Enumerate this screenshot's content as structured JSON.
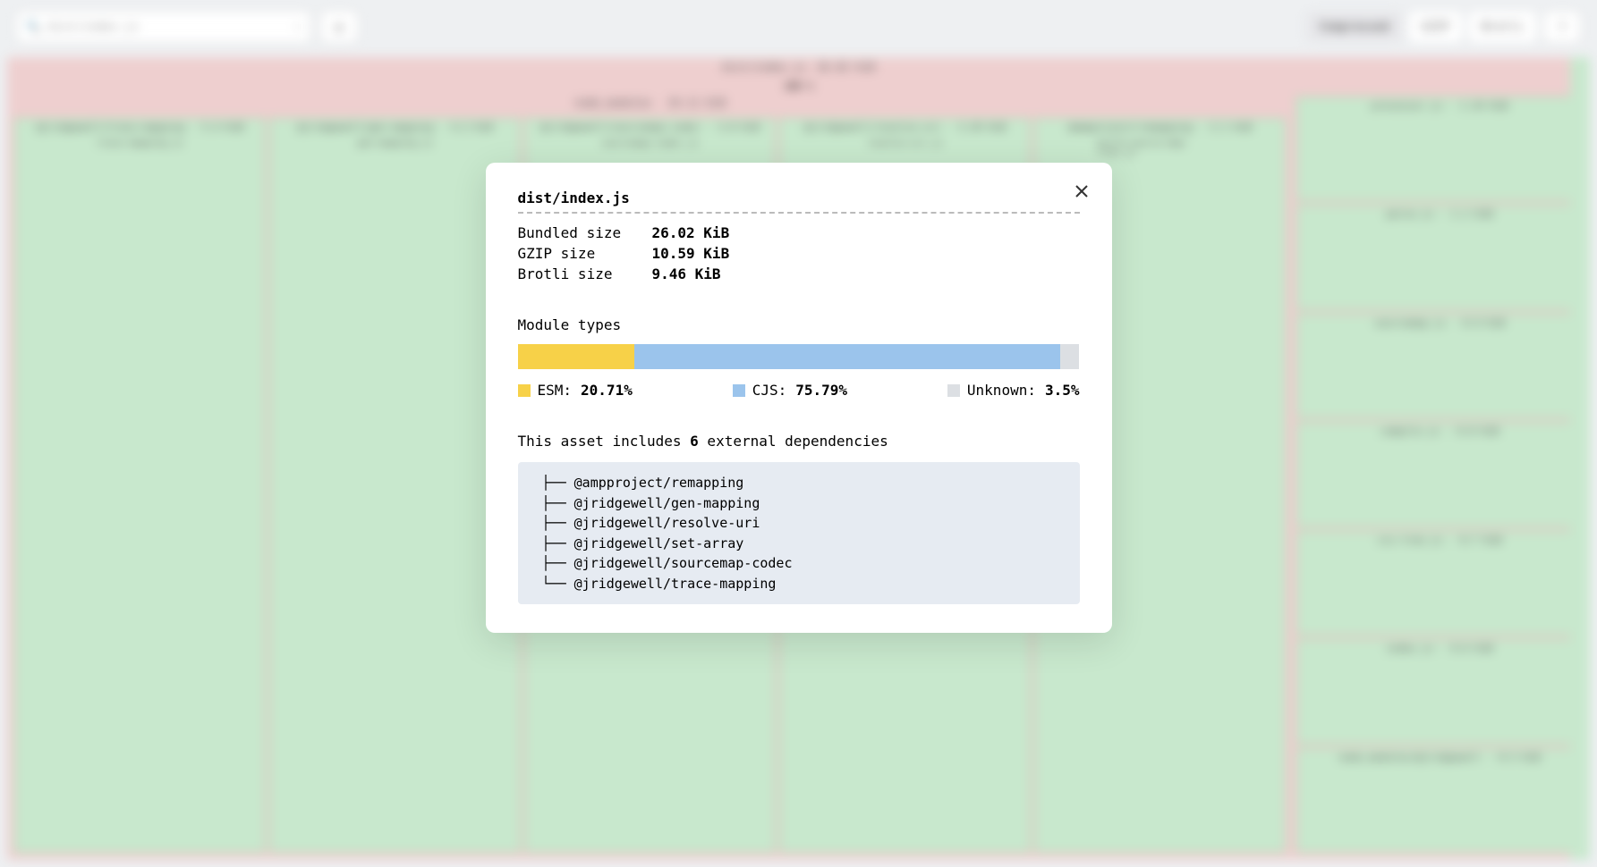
{
  "toolbar": {
    "search_placeholder": "dist/index.js",
    "rebuild_label": "Compressed",
    "gzip_label": "GZIP",
    "brotli_label": "Brotli"
  },
  "treemap": {
    "root_name": "dist/index.js",
    "root_size": "26.02 KiB",
    "root_pct": "100 %",
    "node_modules_name": "node_modules",
    "node_modules_size": "19.11 KiB",
    "boxes": [
      {
        "name": "@jridgewell/trace-mapping",
        "size": "5.4 KiB",
        "sub": "trace-mapping.js"
      },
      {
        "name": "@jridgewell/gen-mapping",
        "size": "4.2 KiB",
        "sub": "gen-mapping.js"
      },
      {
        "name": "@jridgewell/sourcemap-codec",
        "size": "3.8 KiB",
        "sub": "sourcemap-codec.js"
      },
      {
        "name": "@jridgewell/resolve-uri",
        "size": "3.20 KiB",
        "sub": "resolve-uri.js"
      },
      {
        "name": "@ampproject/remapping",
        "size": "2.1 KiB",
        "sub": "build-source-map-tree.js"
      }
    ],
    "right_col": [
      {
        "name": "processor.js",
        "size": "1.34 KiB"
      },
      {
        "name": "parse.js",
        "size": "1.1 KiB"
      },
      {
        "name": "sourcemap.js",
        "size": "0.9 KiB"
      },
      {
        "name": "compile.js",
        "size": "0.8 KiB"
      },
      {
        "name": "css-tree.js",
        "size": "0.7 KiB"
      },
      {
        "name": "index.js",
        "size": "0.6 KiB"
      },
      {
        "name": "node_modules/@jridgewell",
        "size": "0.5 KiB"
      }
    ]
  },
  "modal": {
    "title": "dist/index.js",
    "sizes": [
      {
        "label": "Bundled size",
        "value": "26.02 KiB"
      },
      {
        "label": "GZIP size",
        "value": "10.59 KiB"
      },
      {
        "label": "Brotli size",
        "value": "9.46 KiB"
      }
    ],
    "module_types_label": "Module types",
    "legend": [
      {
        "label": "ESM:",
        "value": "20.71%",
        "color": "#f7d148"
      },
      {
        "label": "CJS:",
        "value": "75.79%",
        "color": "#9bc4ec"
      },
      {
        "label": "Unknown:",
        "value": "3.5%",
        "color": "#dcdfe3"
      }
    ],
    "deps_prefix": "This asset includes ",
    "deps_count": "6",
    "deps_suffix": " external dependencies",
    "deps": [
      "@ampproject/remapping",
      "@jridgewell/gen-mapping",
      "@jridgewell/resolve-uri",
      "@jridgewell/set-array",
      "@jridgewell/sourcemap-codec",
      "@jridgewell/trace-mapping"
    ]
  },
  "chart_data": {
    "type": "bar",
    "title": "Module types",
    "orientation": "horizontal-stacked",
    "categories": [
      "ESM",
      "CJS",
      "Unknown"
    ],
    "values": [
      20.71,
      75.79,
      3.5
    ],
    "colors": [
      "#f7d148",
      "#9bc4ec",
      "#dcdfe3"
    ],
    "unit": "%",
    "xlim": [
      0,
      100
    ]
  }
}
